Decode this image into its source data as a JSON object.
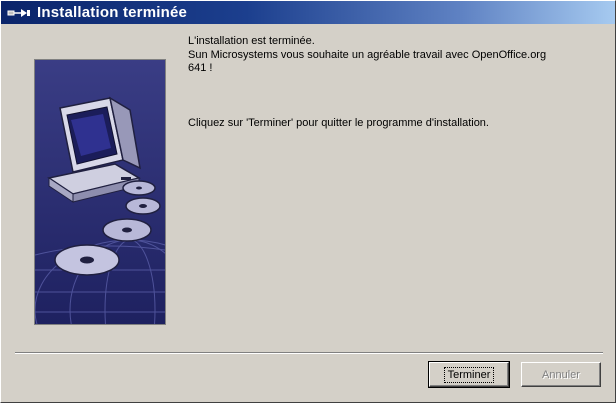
{
  "window": {
    "title": "Installation terminée"
  },
  "message": {
    "line1": "L'installation est terminée.",
    "line2": "Sun Microsystems vous souhaite un agréable travail avec OpenOffice.org",
    "line3": "641 !",
    "line4": "Cliquez sur 'Terminer' pour quitter le programme d'installation."
  },
  "buttons": {
    "finish_label": "Terminer",
    "cancel_label": "Annuler"
  },
  "colors": {
    "titlebar_start": "#0a246a",
    "titlebar_end": "#a6caf0",
    "dialog_bg": "#d4d0c8",
    "image_bg": "#2b2e74"
  },
  "icons": {
    "title": "setup-app-icon",
    "illustration": "computer-with-cds-illustration"
  }
}
